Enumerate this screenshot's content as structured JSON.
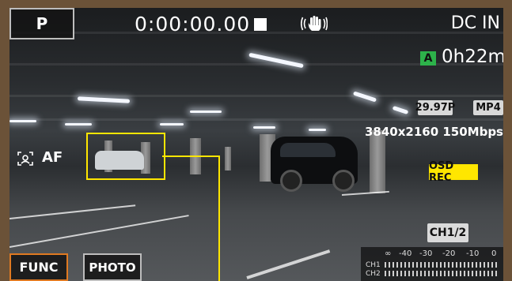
{
  "header": {
    "shooting_mode": "P",
    "timecode": "0:00:00.00",
    "stabilizer_icon": "hand-stabilizer-icon",
    "power_source": "DC IN"
  },
  "recording": {
    "media_slot": "A",
    "media_slot_color": "#2db24a",
    "remaining_time": "0h22m",
    "frame_rate": "29.97P",
    "file_format": "MP4",
    "resolution_bitrate": "3840x2160 150Mbps",
    "osd_rec": "OSD REC",
    "osd_rec_color": "#ffe600"
  },
  "focus": {
    "af_label": "AF",
    "af_icon": "face-tracking-icon"
  },
  "audio": {
    "channel_label": "CH1/2",
    "scale": [
      "∞",
      "-40",
      "-30",
      "-20",
      "-10",
      "0"
    ],
    "ch1": "CH1",
    "ch2": "CH2"
  },
  "buttons": {
    "func_label": "FUNC",
    "func_border_color": "#e07a22",
    "photo_label": "PHOTO"
  }
}
